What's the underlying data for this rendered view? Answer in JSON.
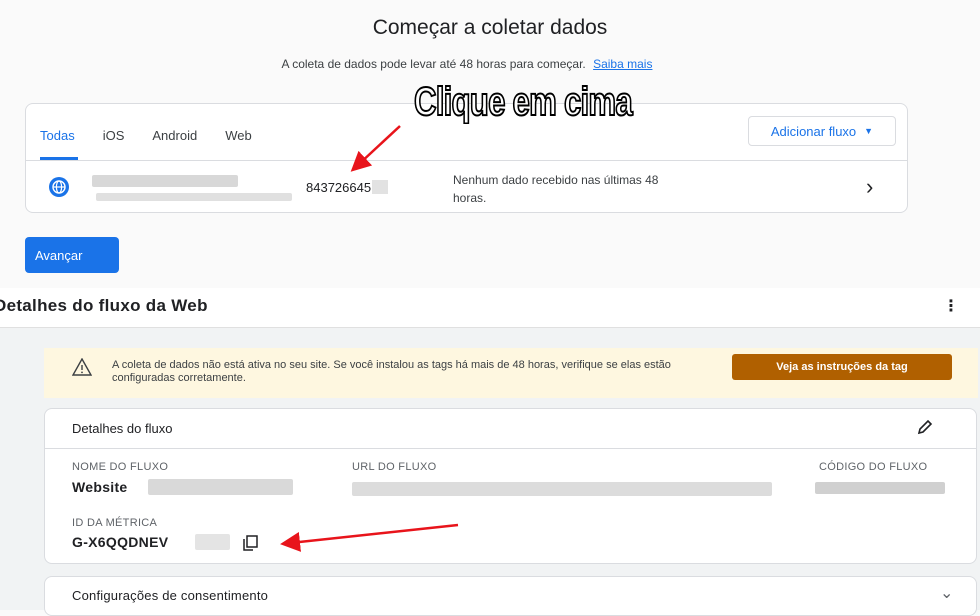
{
  "top": {
    "title": "Começar a coletar dados",
    "subtitle": "A coleta de dados pode levar até 48 horas para começar.",
    "learn_more": "Saiba mais",
    "tabs": [
      "Todas",
      "iOS",
      "Android",
      "Web"
    ],
    "add_stream": "Adicionar fluxo",
    "stream_id": "843726645",
    "stream_status": "Nenhum dado recebido nas últimas 48 horas.",
    "next_button": "Avançar"
  },
  "annotation": {
    "caption": "Clique em cima"
  },
  "panel": {
    "title": "Detalhes do fluxo da Web",
    "warning_text": "A coleta de dados não está ativa no seu site. Se você instalou as tags há mais de 48 horas, verifique se elas estão configuradas corretamente.",
    "warning_button": "Veja as instruções da tag",
    "details_title": "Detalhes do fluxo",
    "stream_name_label": "NOME DO FLUXO",
    "stream_name_value": "Website",
    "stream_url_label": "URL DO FLUXO",
    "stream_code_label": "CÓDIGO DO FLUXO",
    "measurement_id_label": "ID DA MÉTRICA",
    "measurement_id_value": "G-X6QQDNEV",
    "consent_title": "Configurações de consentimento"
  },
  "colors": {
    "accent": "#1a73e8",
    "warning_bg": "#fef7e0",
    "warning_button": "#b06000",
    "annotation_arrow": "#e8141b"
  }
}
